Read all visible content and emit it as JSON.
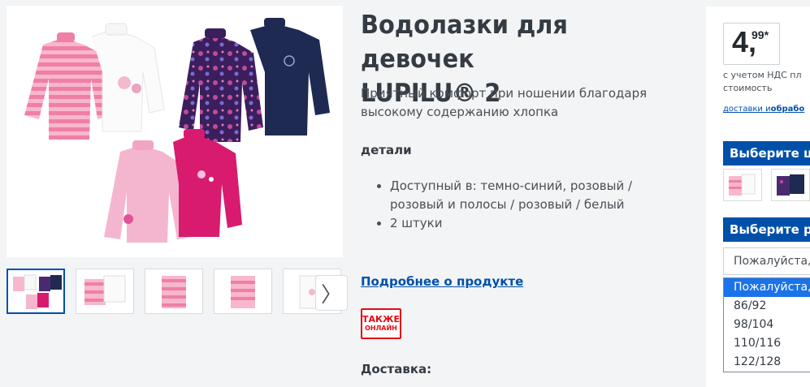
{
  "product": {
    "title_line1": "Водолазки для девочек",
    "title_line2": "LUPILU® 2",
    "subtitle": "Приятный комфорт при ношении благодаря высокому содержанию хлопка",
    "details_heading": "детали",
    "features": [
      "Доступный в: темно-синий, розовый / розовый и полосы / розовый / белый",
      "2 штуки"
    ],
    "more_link": "Подробнее о продукте",
    "online_badge": {
      "line1": "ТАКЖЕ",
      "line2": "ОНЛАЙН"
    },
    "delivery_heading": "Доставка:"
  },
  "gallery": {
    "next_icon": "chevron-right-icon",
    "thumbs": [
      "both-sets",
      "pink-white-set",
      "pink-striped",
      "pink-striped-back",
      "white-shirt"
    ]
  },
  "buy_box": {
    "price_main": "4,",
    "price_cents": "99*",
    "vat_line1": "с учетом НДС пл",
    "vat_line2": "стоимость",
    "delivery_link": "доставки и",
    "delivery_bold": "обрабо",
    "choose_color": "Выберите цв",
    "choose_size": "Выберите ра",
    "size_placeholder": "Пожалуйста, ",
    "size_options": [
      "Пожалуйста, ",
      "86/92",
      "98/104",
      "110/116",
      "122/128"
    ]
  },
  "colors": {
    "accent": "#0050aa",
    "badge_red": "#e60a14",
    "pink": "#ee8fb5",
    "magenta": "#d81b6e",
    "navy": "#1e2a52"
  }
}
